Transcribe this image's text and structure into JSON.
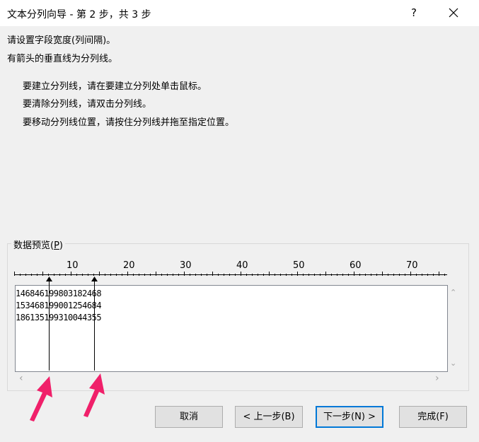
{
  "window": {
    "title": "文本分列向导 - 第 2 步，共 3 步",
    "help": "?"
  },
  "instructions": {
    "line1": "请设置字段宽度(列间隔)。",
    "line2": "有箭头的垂直线为分列线。",
    "line3": "要建立分列线，请在要建立分列处单击鼠标。",
    "line4": "要清除分列线，请双击分列线。",
    "line5": "要移动分列线位置，请按住分列线并拖至指定位置。"
  },
  "preview": {
    "label_prefix": "数据预览(",
    "label_key": "P",
    "label_suffix": ")",
    "ruler_labels": [
      "10",
      "20",
      "30",
      "40",
      "50",
      "60",
      "70"
    ],
    "rows": [
      "146846199803182468",
      "153468199001254684",
      "186135199310044355"
    ],
    "break_columns": [
      6,
      14
    ]
  },
  "buttons": {
    "cancel": "取消",
    "back": "< 上一步(B)",
    "next": "下一步(N) >",
    "finish": "完成(F)"
  },
  "colors": {
    "accent": "#0078d7",
    "callout_arrow": "#f0206a"
  }
}
